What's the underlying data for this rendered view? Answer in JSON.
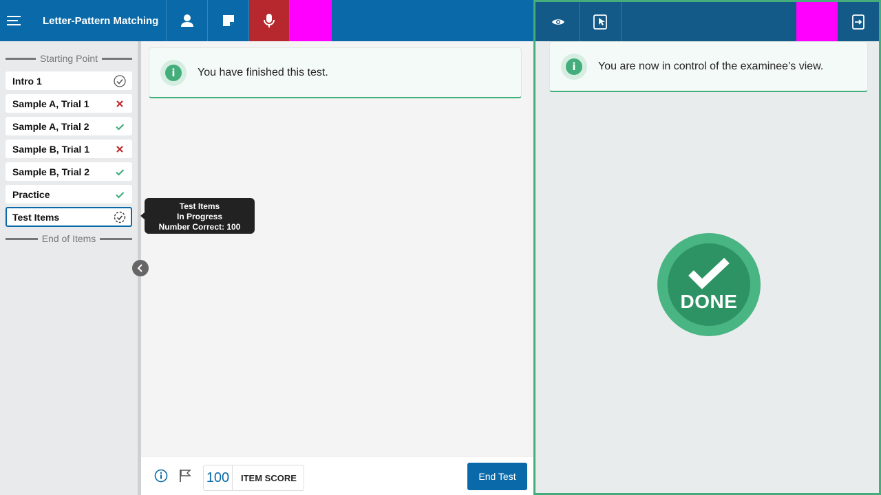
{
  "header": {
    "title": "Letter-Pattern Matching"
  },
  "sidebar": {
    "start_divider": "Starting Point",
    "end_divider": "End of Items",
    "items": [
      {
        "label": "Intro 1",
        "status": "viewed"
      },
      {
        "label": "Sample A, Trial 1",
        "status": "incorrect"
      },
      {
        "label": "Sample A, Trial 2",
        "status": "correct"
      },
      {
        "label": "Sample B, Trial 1",
        "status": "incorrect"
      },
      {
        "label": "Sample B, Trial 2",
        "status": "correct"
      },
      {
        "label": "Practice",
        "status": "correct"
      },
      {
        "label": "Test Items",
        "status": "in-progress"
      }
    ]
  },
  "tooltip": {
    "line1": "Test Items",
    "line2": "In Progress",
    "line3": "Number Correct: 100"
  },
  "main": {
    "banner": "You have finished this test."
  },
  "footer": {
    "score": "100",
    "score_label": "ITEM SCORE",
    "end_button": "End Test"
  },
  "examinee": {
    "banner": "You are now in control of the examinee’s view.",
    "done_label": "DONE"
  },
  "colors": {
    "primary": "#0a6aa9",
    "examinee_bar": "#135a88",
    "record_active": "#b7282e",
    "highlight": "#ff00ff",
    "success": "#43ad7b",
    "error": "#c0282d"
  },
  "icons": [
    "menu-icon",
    "person-icon",
    "note-icon",
    "microphone-icon",
    "eye-icon",
    "touch-screen-icon",
    "exit-icon",
    "info-icon",
    "flag-icon",
    "check-circle-icon",
    "check-icon",
    "x-icon",
    "dashed-check-circle-icon",
    "chevron-left-icon",
    "done-check-icon"
  ]
}
